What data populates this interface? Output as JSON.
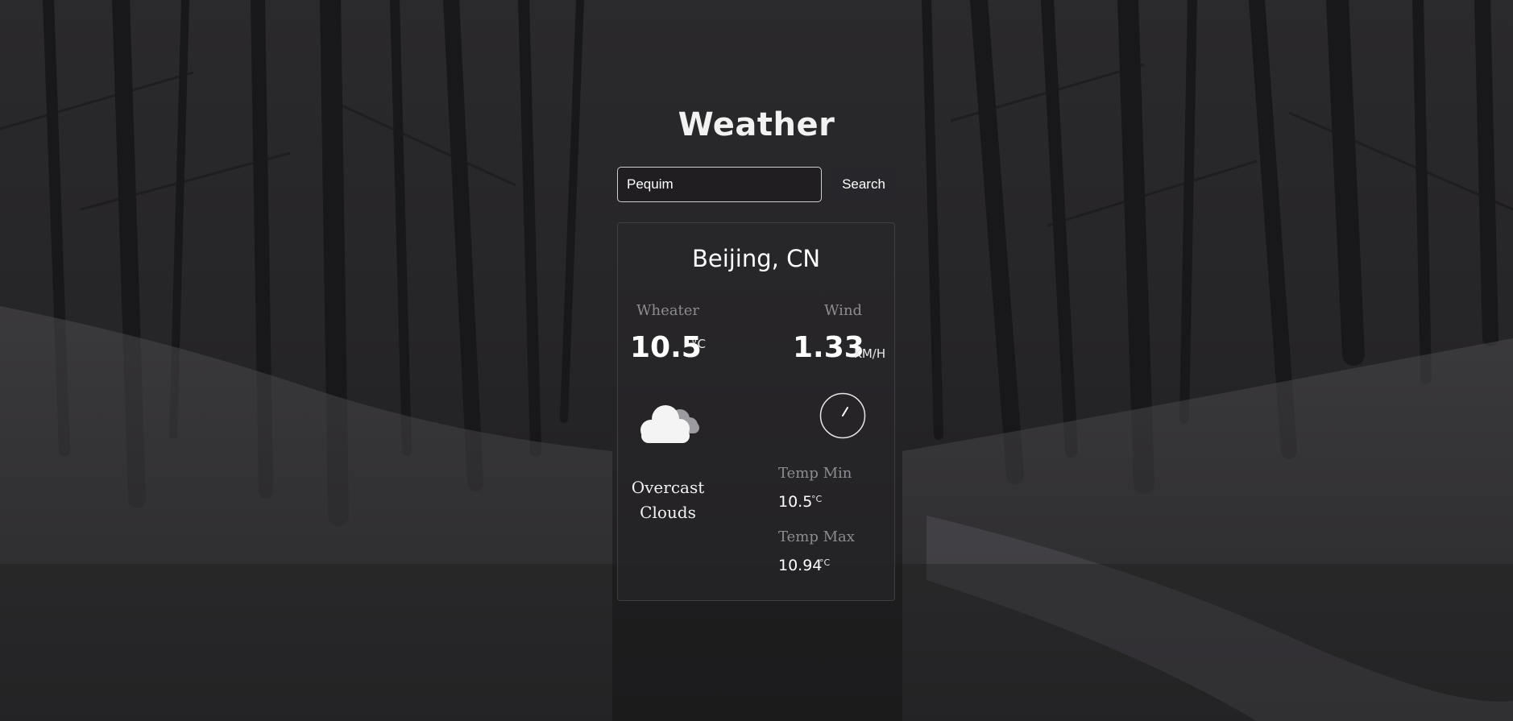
{
  "app": {
    "title": "Weather"
  },
  "search": {
    "value": "Pequim",
    "button_label": "Search"
  },
  "weather": {
    "location": "Beijing, CN",
    "weather_label": "Wheater",
    "temperature": "10.5",
    "temperature_unit": "°C",
    "description_line1": "Overcast",
    "description_line2": "Clouds",
    "icon": "cloud-icon",
    "wind_label": "Wind",
    "wind_speed": "1.33",
    "wind_unit": "KM/H",
    "wind_icon": "compass-icon",
    "temp_min_label": "Temp Min",
    "temp_min": "10.5",
    "temp_min_unit": "°C",
    "temp_max_label": "Temp Max",
    "temp_max": "10.94",
    "temp_max_unit": "°C"
  },
  "colors": {
    "background": "#1f1e20",
    "card_border": "#3f3e42",
    "label": "#8d8c91",
    "text": "#ffffff"
  }
}
